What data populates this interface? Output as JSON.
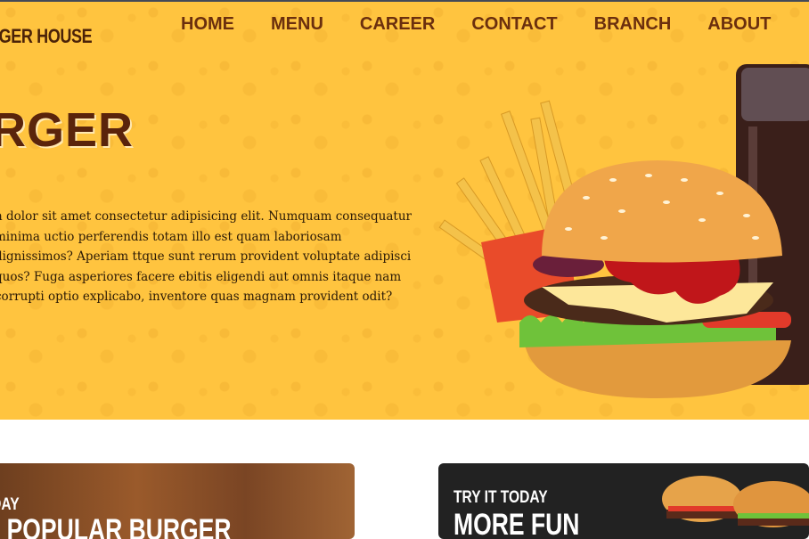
{
  "header": {
    "brand": "RGER HOUSE",
    "nav": [
      "HOME",
      "MENU",
      "CAREER",
      "CONTACT",
      "BRANCH",
      "ABOUT"
    ]
  },
  "hero": {
    "title": "RGER",
    "body": "n dolor sit amet consectetur adipisicing elit. Numquam consequatur minima uctio perferendis totam illo est quam laboriosam dignissimos? Aperiam ttque sunt rerum provident voluptate adipisci quos? Fuga asperiores facere ebitis eligendi aut omnis itaque nam corrupti optio explicabo, inventore quas magnam provident odit?",
    "image_icon": "burger-fries-drink-image"
  },
  "promos": [
    {
      "kicker": "ODAY",
      "heading": "T POPULAR BURGER"
    },
    {
      "kicker": "TRY IT TODAY",
      "heading": "MORE FUN",
      "image_icon": "burgers-image"
    }
  ],
  "colors": {
    "hero_bg": "#ffc43f",
    "nav_text": "#6b2f0e",
    "title_text": "#5a240b"
  }
}
